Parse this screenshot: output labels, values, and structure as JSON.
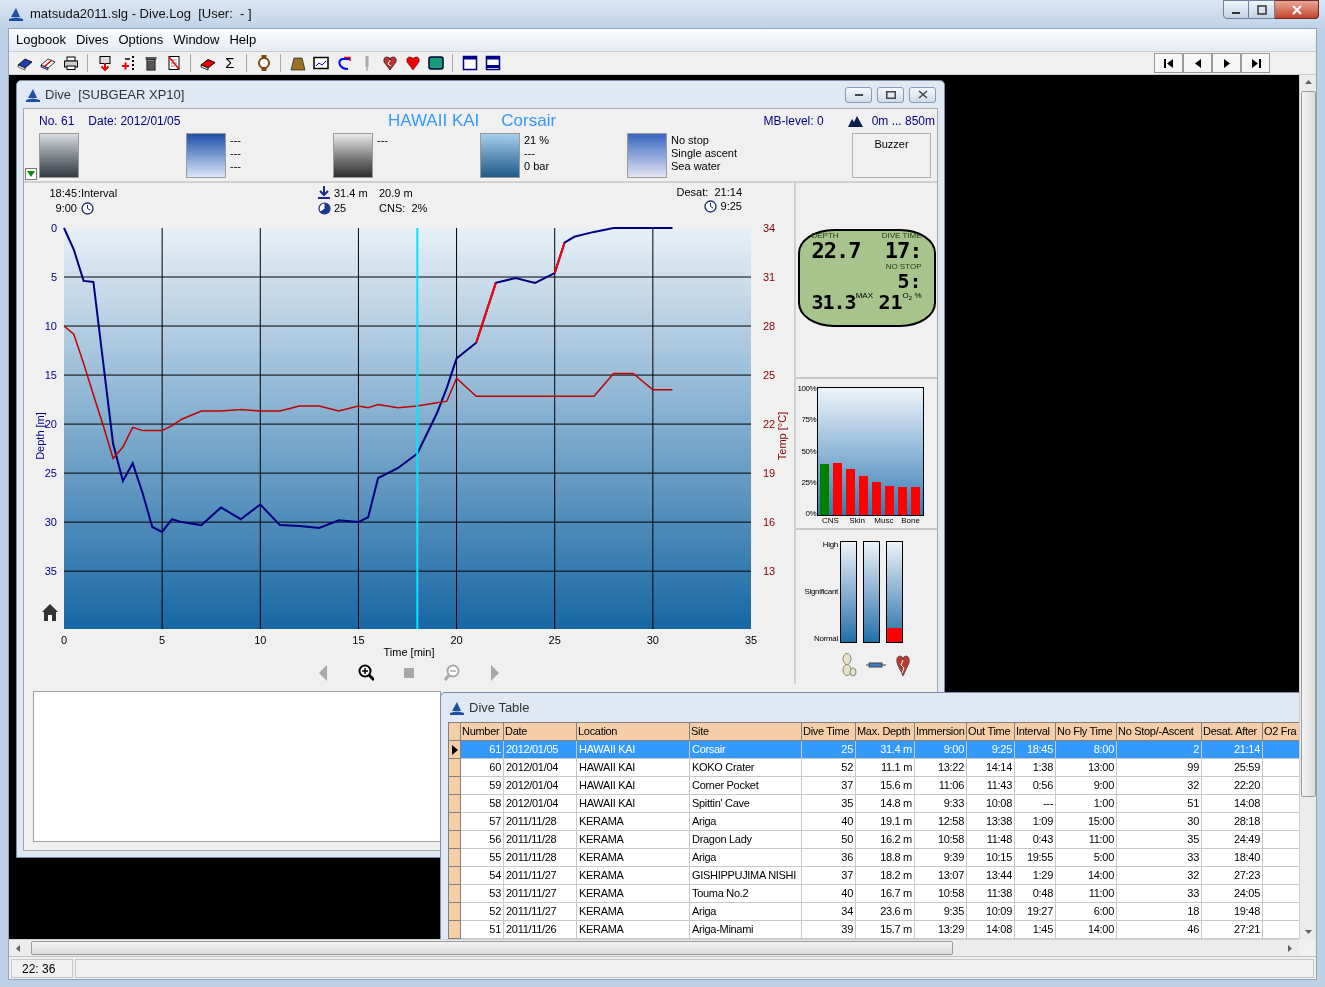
{
  "window": {
    "title": "matsuda2011.slg - Dive.Log  [User:  - ]"
  },
  "menu": [
    "Logbook",
    "Dives",
    "Options",
    "Window",
    "Help"
  ],
  "toolbar": {
    "sum": "Σ"
  },
  "dive_window": {
    "title": "Dive  [SUBGEAR XP10]",
    "number": "No. 61",
    "date": "Date: 2012/01/05",
    "location": "HAWAII KAI",
    "site": "Corsair",
    "mb_level": "MB-level: 0",
    "altitude": "0m ... 850m",
    "panels": [
      {
        "kind": "buddies"
      },
      {
        "kind": "weather",
        "lines": [
          "---",
          "---",
          "---"
        ]
      },
      {
        "kind": "equipment",
        "lines": [
          "---"
        ]
      },
      {
        "kind": "tanks",
        "lines": [
          "21 %",
          "---",
          "0 bar"
        ]
      },
      {
        "kind": "conditions",
        "lines": [
          "No stop",
          "Single ascent",
          "Sea water"
        ]
      }
    ],
    "buzzer": "Buzzer",
    "stats": {
      "interval": "18:45",
      "interval_label": ":Interval",
      "immersion": "9:00",
      "max_depth": "31.4 m",
      "avg_depth": "20.9 m",
      "dive_time": "25",
      "cns": "CNS:  2%",
      "desat": "Desat:  21:14",
      "out_time": "9:25"
    },
    "profile": {
      "y2label": "Temp [°C]",
      "chart_data": {
        "type": "line",
        "xlabel": "Time [min]",
        "ylabel": "Depth [m]",
        "xlim": [
          0,
          35
        ],
        "ylim": [
          40.9,
          0
        ],
        "y2lim": [
          9.46,
          34
        ],
        "xticks": [
          0,
          5,
          10,
          15,
          20,
          25,
          30,
          35
        ],
        "yticks": [
          0,
          5,
          10,
          15,
          20,
          25,
          30,
          35
        ],
        "y2ticks": [
          34,
          31,
          28,
          25,
          22,
          19,
          16,
          13
        ],
        "x": [
          0,
          0.5,
          1,
          1.5,
          2,
          2.5,
          3,
          3.5,
          4,
          4.5,
          5,
          5.5,
          6,
          7,
          8,
          9,
          10,
          11,
          12,
          13,
          14,
          15,
          15.5,
          16,
          17,
          18,
          19,
          19.5,
          20,
          21,
          22,
          23,
          24,
          25,
          25.5,
          26,
          27,
          28,
          29,
          30,
          31
        ],
        "series": [
          {
            "color": "#000080",
            "values": [
              0,
              2.2,
              5.4,
              5.5,
              13.8,
              22,
              25.8,
              24,
              27,
              30.5,
              31,
              29.7,
              30,
              30.3,
              28.5,
              29.7,
              28.2,
              30.3,
              30.4,
              30.6,
              29.8,
              30,
              29.5,
              25.5,
              24.5,
              23,
              18.9,
              16.3,
              13.3,
              11.7,
              5.6,
              5.1,
              5.6,
              4.6,
              1.5,
              0.9,
              0.4,
              0,
              0,
              0,
              0
            ]
          },
          {
            "color": "#c00000",
            "axis": "y2",
            "values": [
              28,
              27.5,
              25.7,
              23.8,
              21.9,
              19.9,
              20.6,
              21.8,
              21.6,
              21.6,
              21.6,
              21.9,
              22.3,
              22.8,
              22.8,
              22.9,
              22.8,
              22.8,
              23.1,
              23.1,
              22.8,
              23.1,
              23.0,
              23.2,
              23.0,
              23.1,
              23.3,
              23.4,
              24.8,
              23.7,
              23.7,
              23.7,
              23.7,
              23.7,
              23.7,
              23.7,
              23.7,
              25.1,
              25.1,
              24.1,
              24.1
            ]
          },
          {
            "color": "#ff0000",
            "values": [
              null,
              null,
              null,
              null,
              null,
              null,
              null,
              null,
              null,
              null,
              null,
              null,
              null,
              null,
              null,
              null,
              null,
              null,
              null,
              null,
              null,
              null,
              null,
              null,
              null,
              null,
              null,
              null,
              null,
              11.7,
              5.6,
              null,
              null,
              4.6,
              1.5,
              null,
              null,
              null,
              null,
              null,
              null
            ]
          }
        ],
        "grid": true,
        "ref_lines": [
          {
            "axis": "x",
            "value": 18,
            "color": "#00e8ff"
          }
        ]
      }
    },
    "nav": [
      {
        "kind": "left",
        "disabled": true
      },
      {
        "kind": "zoom-in",
        "disabled": false
      },
      {
        "kind": "stop",
        "disabled": true
      },
      {
        "kind": "zoom-out",
        "disabled": true
      },
      {
        "kind": "right",
        "disabled": true
      }
    ],
    "computer": {
      "depth_label": "DEPTH",
      "depth": "22.7",
      "time_label": "DIVE TIME",
      "time": "17:",
      "nostop_label": "NO STOP",
      "nostop": "5:",
      "max": "31.3",
      "max_label": "MAX",
      "o2": "21",
      "o2_label": "O$_{2}$ %"
    },
    "tissues": {
      "yticks": [
        "100%",
        "75%",
        "50%",
        "25%",
        "0%"
      ],
      "labels": [
        "CNS",
        "Skin",
        "Musc",
        "Bone"
      ],
      "bars": [
        {
          "level": 0.4,
          "color": "#008000"
        },
        {
          "level": 0.41,
          "color": "#ff0000"
        },
        {
          "level": 0.36,
          "color": "#ff0000"
        },
        {
          "level": 0.31,
          "color": "#ff0000"
        },
        {
          "level": 0.26,
          "color": "#ff0000"
        },
        {
          "level": 0.23,
          "color": "#ff0000"
        },
        {
          "level": 0.22,
          "color": "#ff0000"
        },
        {
          "level": 0.22,
          "color": "#ff0000"
        }
      ]
    },
    "risk": {
      "labels": [
        "High",
        "Significant",
        "Normal"
      ],
      "meters": [
        {
          "level": 0
        },
        {
          "level": 0
        },
        {
          "level": 0.14
        }
      ]
    }
  },
  "dive_table": {
    "title": "Dive Table",
    "columns": [
      {
        "label": "Number",
        "kind": "number"
      },
      {
        "label": "Date",
        "kind": "text"
      },
      {
        "label": "Location",
        "kind": "text"
      },
      {
        "label": "Site",
        "kind": "text"
      },
      {
        "label": "Dive Time",
        "kind": "number"
      },
      {
        "label": "Max. Depth",
        "kind": "number"
      },
      {
        "label": "Immersion",
        "kind": "number"
      },
      {
        "label": "Out Time",
        "kind": "number"
      },
      {
        "label": "Interval",
        "kind": "number"
      },
      {
        "label": "No Fly Time",
        "kind": "number"
      },
      {
        "label": "No Stop/-Ascent",
        "kind": "number"
      },
      {
        "label": "Desat. After",
        "kind": "number"
      },
      {
        "label": "O2 Fra",
        "kind": "number"
      }
    ],
    "rows": [
      {
        "selected": true,
        "cells": [
          "61",
          "2012/01/05",
          "HAWAII KAI",
          "Corsair",
          "25",
          "31.4 m",
          "9:00",
          "9:25",
          "18:45",
          "8:00",
          "2",
          "21:14"
        ]
      },
      {
        "selected": false,
        "cells": [
          "60",
          "2012/01/04",
          "HAWAII KAI",
          "KOKO Crater",
          "52",
          "11.1 m",
          "13:22",
          "14:14",
          "1:38",
          "13:00",
          "99",
          "25:59"
        ]
      },
      {
        "selected": false,
        "cells": [
          "59",
          "2012/01/04",
          "HAWAII KAI",
          "Corner Pocket",
          "37",
          "15.6 m",
          "11:06",
          "11:43",
          "0:56",
          "9:00",
          "32",
          "22:20"
        ]
      },
      {
        "selected": false,
        "cells": [
          "58",
          "2012/01/04",
          "HAWAII KAI",
          "Spittin' Cave",
          "35",
          "14.8 m",
          "9:33",
          "10:08",
          "---",
          "1:00",
          "51",
          "14:08"
        ]
      },
      {
        "selected": false,
        "cells": [
          "57",
          "2011/11/28",
          "KERAMA",
          "Ariga",
          "40",
          "19.1 m",
          "12:58",
          "13:38",
          "1:09",
          "15:00",
          "30",
          "28:18"
        ]
      },
      {
        "selected": false,
        "cells": [
          "56",
          "2011/11/28",
          "KERAMA",
          "Dragon Lady",
          "50",
          "16.2 m",
          "10:58",
          "11:48",
          "0:43",
          "11:00",
          "35",
          "24:49"
        ]
      },
      {
        "selected": false,
        "cells": [
          "55",
          "2011/11/28",
          "KERAMA",
          "Ariga",
          "36",
          "18.8 m",
          "9:39",
          "10:15",
          "19:55",
          "5:00",
          "33",
          "18:40"
        ]
      },
      {
        "selected": false,
        "cells": [
          "54",
          "2011/11/27",
          "KERAMA",
          "GISHIPPUJIMA NISHI",
          "37",
          "18.2 m",
          "13:07",
          "13:44",
          "1:29",
          "14:00",
          "32",
          "27:23"
        ]
      },
      {
        "selected": false,
        "cells": [
          "53",
          "2011/11/27",
          "KERAMA",
          "Touma No.2",
          "40",
          "16.7 m",
          "10:58",
          "11:38",
          "0:48",
          "11:00",
          "33",
          "24:05"
        ]
      },
      {
        "selected": false,
        "cells": [
          "52",
          "2011/11/27",
          "KERAMA",
          "Ariga",
          "34",
          "23.6 m",
          "9:35",
          "10:09",
          "19:27",
          "6:00",
          "18",
          "19:48"
        ]
      },
      {
        "selected": false,
        "cells": [
          "51",
          "2011/11/26",
          "KERAMA",
          "Ariga-Minami",
          "39",
          "15.7 m",
          "13:29",
          "14:08",
          "1:45",
          "14:00",
          "46",
          "27:21"
        ]
      }
    ]
  },
  "status_bar": [
    "22: 36"
  ]
}
